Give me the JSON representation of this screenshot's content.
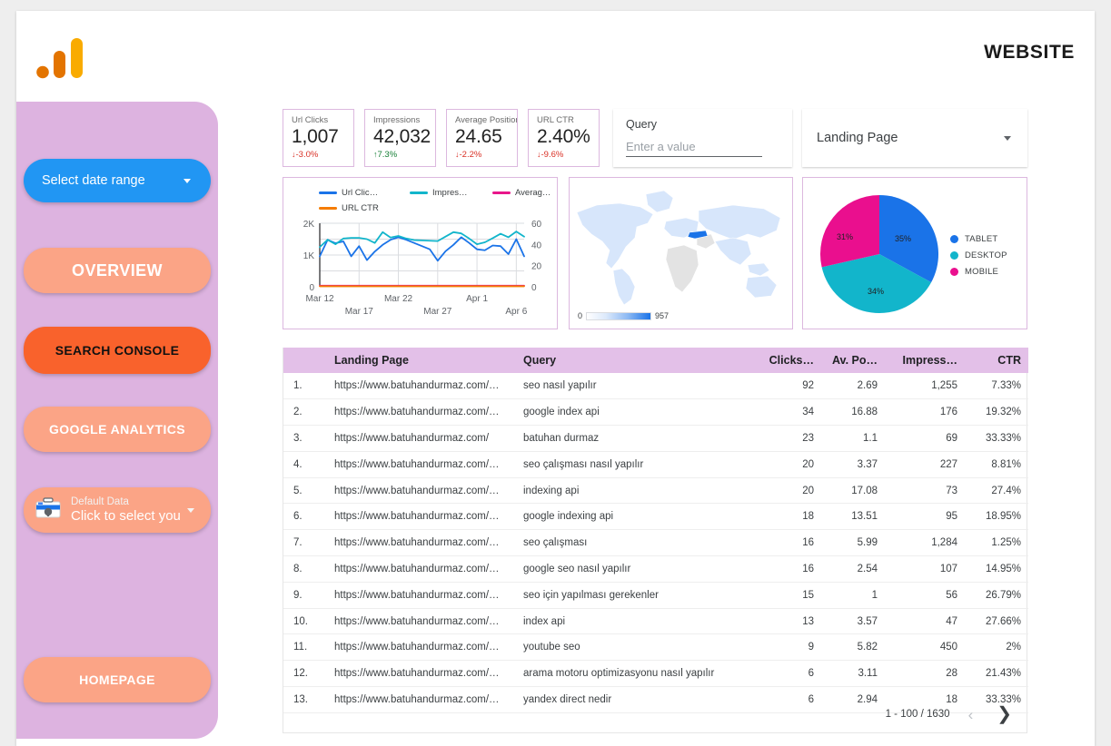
{
  "header": {
    "logo_icon": "google-analytics-logo",
    "title": "WEBSITE"
  },
  "sidebar": {
    "date_range": {
      "label": "Select date range",
      "icon": "chevron-down-icon"
    },
    "nav_items": [
      {
        "label": "OVERVIEW"
      },
      {
        "label": "SEARCH CONSOLE"
      },
      {
        "label": "GOOGLE ANALYTICS"
      },
      {
        "label": "HOMEPAGE"
      }
    ],
    "datasource": {
      "icon": "data-source-toolbox-icon",
      "line1": "Default Data",
      "line2": "Click to select you",
      "caret_icon": "chevron-down-icon"
    }
  },
  "scorecards": [
    {
      "title": "Url Clicks",
      "value": "1,007",
      "delta": "-3.0%",
      "direction": "down",
      "arrow": "↓"
    },
    {
      "title": "Impressions",
      "value": "42,032",
      "delta": "7.3%",
      "direction": "up",
      "arrow": "↑"
    },
    {
      "title": "Average Position",
      "value": "24.65",
      "delta": "-2.2%",
      "direction": "down",
      "arrow": "↓"
    },
    {
      "title": "URL CTR",
      "value": "2.40%",
      "delta": "-9.6%",
      "direction": "down",
      "arrow": "↓"
    }
  ],
  "filters": {
    "query": {
      "label": "Query",
      "value": "",
      "placeholder": "Enter a value"
    },
    "landing_page": {
      "label": "Landing Page",
      "caret_icon": "chevron-down-icon"
    }
  },
  "chart_data": [
    {
      "type": "line",
      "title": "",
      "legend_position": "top",
      "xlabel": "",
      "ylabel": "",
      "ylim": [
        0,
        2000
      ],
      "y2lim": [
        0,
        60
      ],
      "ytick_labels": [
        "0",
        "1K",
        "2K"
      ],
      "y2tick_labels": [
        "0",
        "20",
        "40",
        "60"
      ],
      "grid": true,
      "x": [
        "Mar 12",
        "Mar 13",
        "Mar 14",
        "Mar 15",
        "Mar 16",
        "Mar 17",
        "Mar 18",
        "Mar 19",
        "Mar 20",
        "Mar 21",
        "Mar 22",
        "Mar 23",
        "Mar 24",
        "Mar 25",
        "Mar 26",
        "Mar 27",
        "Mar 28",
        "Mar 29",
        "Mar 30",
        "Mar 31",
        "Apr 1",
        "Apr 2",
        "Apr 3",
        "Apr 4",
        "Apr 5",
        "Apr 6",
        "Apr 7"
      ],
      "xtick_labels": [
        "Mar 12",
        "Mar 17",
        "Mar 22",
        "Mar 27",
        "Apr 1",
        "Apr 6"
      ],
      "series": [
        {
          "name": "Url Clic…",
          "full_name": "Url Clicks",
          "color": "#1a73e8",
          "axis": "left",
          "values": [
            960,
            1480,
            1370,
            1430,
            960,
            1280,
            840,
            1110,
            1320,
            1480,
            1560,
            1480,
            1380,
            1280,
            1180,
            820,
            1120,
            1320,
            1560,
            1380,
            1180,
            1150,
            1300,
            1280,
            1030,
            1500,
            960
          ]
        },
        {
          "name": "Impres…",
          "full_name": "Impressions",
          "color": "#12b5cb",
          "axis": "left",
          "values": [
            1250,
            1480,
            1340,
            1520,
            1540,
            1540,
            1500,
            1380,
            1720,
            1550,
            1600,
            1520,
            1470,
            1460,
            1450,
            1440,
            1580,
            1720,
            1680,
            1520,
            1340,
            1400,
            1530,
            1670,
            1560,
            1740,
            1580
          ]
        },
        {
          "name": "Averag…",
          "full_name": "Average Position",
          "color": "#e8168a",
          "axis": "right",
          "values": [
            1,
            1,
            1,
            1,
            1,
            1,
            1,
            1,
            1,
            1,
            1,
            1,
            1,
            1,
            1,
            1,
            1,
            1,
            1,
            1,
            1,
            1,
            1,
            1,
            1,
            1,
            1
          ]
        },
        {
          "name": "URL CTR",
          "full_name": "URL CTR",
          "color": "#f57c00",
          "axis": "right",
          "values": [
            0.5,
            0.5,
            0.5,
            0.5,
            0.5,
            0.5,
            0.5,
            0.5,
            0.5,
            0.5,
            0.5,
            0.5,
            0.5,
            0.5,
            0.5,
            0.5,
            0.5,
            0.5,
            0.5,
            0.5,
            0.5,
            0.5,
            0.5,
            0.5,
            0.5,
            0.5,
            0.5
          ]
        }
      ]
    },
    {
      "type": "heatmap",
      "subtype": "geo-map",
      "title": "",
      "legend_min": "0",
      "legend_max": "957",
      "highlighted_region": "Turkey",
      "highlight_color": "#1a73e8",
      "base_color": "#d7e6fb"
    },
    {
      "type": "pie",
      "title": "",
      "legend_position": "right",
      "categories": [
        "TABLET",
        "DESKTOP",
        "MOBILE"
      ],
      "values": [
        35,
        34,
        31
      ],
      "value_labels": [
        "35%",
        "34%",
        "31%"
      ],
      "colors": [
        "#1a73e8",
        "#12b5cb",
        "#ea0f8e"
      ]
    }
  ],
  "table": {
    "columns": [
      "",
      "Landing Page",
      "Query",
      "Clicks…",
      "Av. Po…",
      "Impress…",
      "CTR"
    ],
    "rows": [
      {
        "idx": "1.",
        "landing_page": "https://www.batuhandurmaz.com/…",
        "query": "seo nasıl yapılır",
        "clicks": "92",
        "position": "2.69",
        "impressions": "1,255",
        "ctr": "7.33%"
      },
      {
        "idx": "2.",
        "landing_page": "https://www.batuhandurmaz.com/…",
        "query": "google index api",
        "clicks": "34",
        "position": "16.88",
        "impressions": "176",
        "ctr": "19.32%"
      },
      {
        "idx": "3.",
        "landing_page": "https://www.batuhandurmaz.com/",
        "query": "batuhan durmaz",
        "clicks": "23",
        "position": "1.1",
        "impressions": "69",
        "ctr": "33.33%"
      },
      {
        "idx": "4.",
        "landing_page": "https://www.batuhandurmaz.com/…",
        "query": "seo çalışması nasıl yapılır",
        "clicks": "20",
        "position": "3.37",
        "impressions": "227",
        "ctr": "8.81%"
      },
      {
        "idx": "5.",
        "landing_page": "https://www.batuhandurmaz.com/…",
        "query": "indexing api",
        "clicks": "20",
        "position": "17.08",
        "impressions": "73",
        "ctr": "27.4%"
      },
      {
        "idx": "6.",
        "landing_page": "https://www.batuhandurmaz.com/…",
        "query": "google indexing api",
        "clicks": "18",
        "position": "13.51",
        "impressions": "95",
        "ctr": "18.95%"
      },
      {
        "idx": "7.",
        "landing_page": "https://www.batuhandurmaz.com/…",
        "query": "seo çalışması",
        "clicks": "16",
        "position": "5.99",
        "impressions": "1,284",
        "ctr": "1.25%"
      },
      {
        "idx": "8.",
        "landing_page": "https://www.batuhandurmaz.com/…",
        "query": "google seo nasıl yapılır",
        "clicks": "16",
        "position": "2.54",
        "impressions": "107",
        "ctr": "14.95%"
      },
      {
        "idx": "9.",
        "landing_page": "https://www.batuhandurmaz.com/…",
        "query": "seo için yapılması gerekenler",
        "clicks": "15",
        "position": "1",
        "impressions": "56",
        "ctr": "26.79%"
      },
      {
        "idx": "10.",
        "landing_page": "https://www.batuhandurmaz.com/…",
        "query": "index api",
        "clicks": "13",
        "position": "3.57",
        "impressions": "47",
        "ctr": "27.66%"
      },
      {
        "idx": "11.",
        "landing_page": "https://www.batuhandurmaz.com/…",
        "query": "youtube seo",
        "clicks": "9",
        "position": "5.82",
        "impressions": "450",
        "ctr": "2%"
      },
      {
        "idx": "12.",
        "landing_page": "https://www.batuhandurmaz.com/…",
        "query": "arama motoru optimizasyonu nasıl yapılır",
        "clicks": "6",
        "position": "3.11",
        "impressions": "28",
        "ctr": "21.43%"
      },
      {
        "idx": "13.",
        "landing_page": "https://www.batuhandurmaz.com/…",
        "query": "yandex direct nedir",
        "clicks": "6",
        "position": "2.94",
        "impressions": "18",
        "ctr": "33.33%"
      }
    ],
    "pagination": {
      "label": "1 - 100 / 1630",
      "prev_icon": "chevron-left-icon",
      "next_icon": "chevron-right-icon"
    }
  }
}
